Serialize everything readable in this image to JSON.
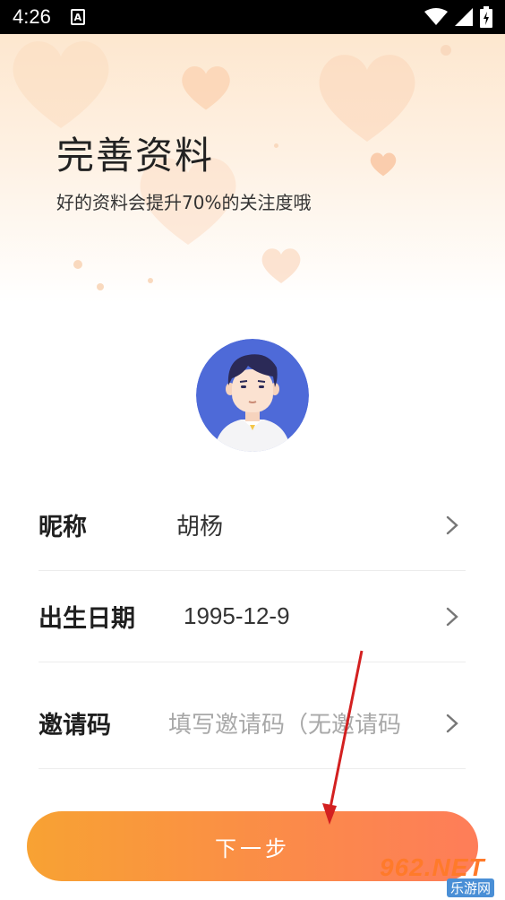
{
  "status_bar": {
    "time": "4:26",
    "app_indicator": "A"
  },
  "header": {
    "title": "完善资料",
    "subtitle": "好的资料会提升70%的关注度哦"
  },
  "avatar": {
    "icon": "user-avatar-illustration"
  },
  "form": {
    "nickname": {
      "label": "昵称",
      "value": "胡杨"
    },
    "birthday": {
      "label": "出生日期",
      "value": "1995-12-9"
    },
    "invite": {
      "label": "邀请码",
      "placeholder": "填写邀请码（无邀请码"
    }
  },
  "next_button": {
    "label": "下一步"
  },
  "watermark": {
    "main": "962.NET",
    "sub": "乐游网"
  },
  "colors": {
    "button_start": "#f8a233",
    "button_end": "#fe7d59",
    "annotation_arrow": "#d32020"
  }
}
